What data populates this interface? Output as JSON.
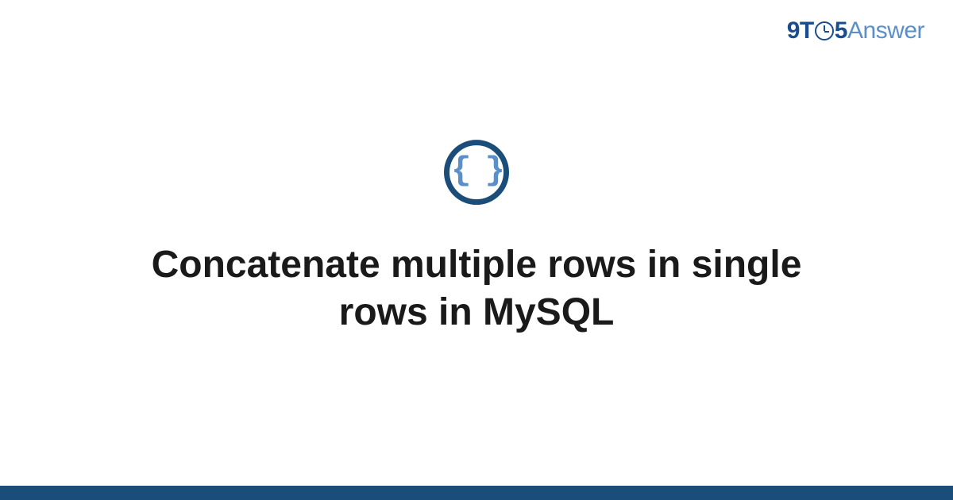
{
  "header": {
    "logo_part1": "9T",
    "logo_part2": "5",
    "logo_part3": "Answer"
  },
  "content": {
    "icon_glyph": "{ }",
    "title": "Concatenate multiple rows in single rows in MySQL"
  },
  "colors": {
    "brand_dark": "#1a4d7a",
    "brand_blue": "#1a4d8f",
    "brand_light": "#5a8fc7"
  }
}
